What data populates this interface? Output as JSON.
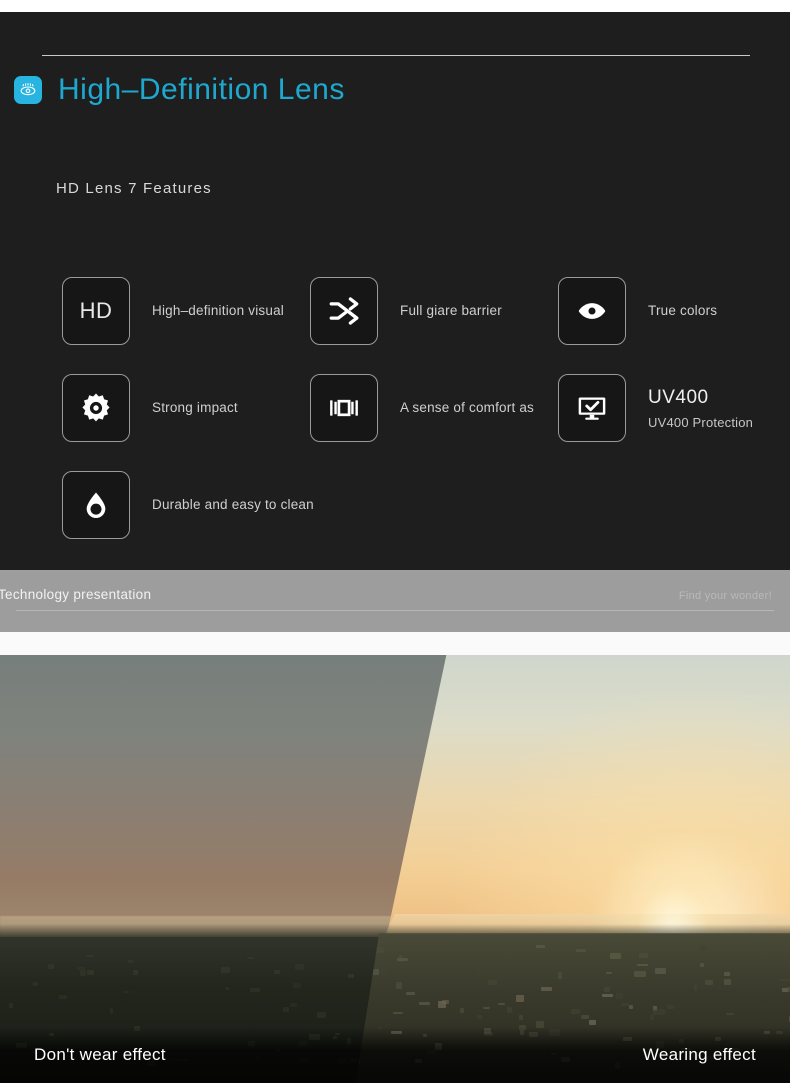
{
  "header": {
    "brand_icon": "eye-icon",
    "brand_icon_color": "#27b4e0",
    "title": "High–Definition Lens",
    "title_color": "#1fa8cf"
  },
  "section": {
    "subtitle": "HD Lens 7 Features"
  },
  "features": [
    [
      {
        "icon": "hd-text-icon",
        "icon_label": "HD",
        "text": "High–definition visual"
      },
      {
        "icon": "shuffle-icon",
        "icon_label": "",
        "text": "Full giare barrier"
      },
      {
        "icon": "eye-icon",
        "icon_label": "",
        "text": "True colors"
      }
    ],
    [
      {
        "icon": "gear-icon",
        "icon_label": "",
        "text": "Strong impact"
      },
      {
        "icon": "panorama-icon",
        "icon_label": "",
        "text": "A sense of comfort as"
      },
      {
        "icon": "monitor-check-icon",
        "icon_label": "",
        "title": "UV400",
        "text": "UV400 Protection"
      }
    ],
    [
      {
        "icon": "water-drop-icon",
        "icon_label": "",
        "text": "Durable and easy to clean"
      }
    ]
  ],
  "footer_band": {
    "left_label": "Technology presentation",
    "right_label": "Find your wonder!",
    "background": "#9d9d9d"
  },
  "comparison": {
    "left_caption": "Don't wear effect",
    "right_caption": "Wearing effect"
  }
}
